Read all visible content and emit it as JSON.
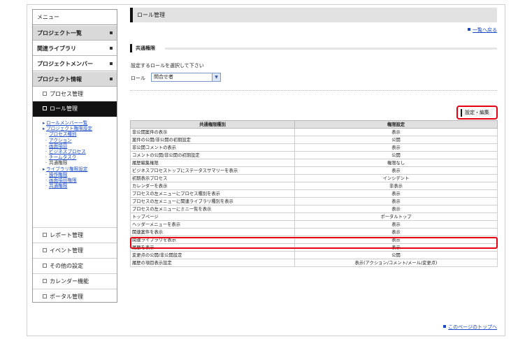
{
  "sidebar": {
    "menu": "メニュー",
    "top_items": [
      {
        "label": "プロジェクト一覧"
      },
      {
        "label": "関連ライブラリ"
      },
      {
        "label": "プロジェクトメンバー"
      },
      {
        "label": "プロジェクト情報"
      }
    ],
    "sub_items": [
      {
        "label": "プロセス管理"
      },
      {
        "label": "ロール管理"
      }
    ],
    "links": [
      {
        "label": "ロールメンバー一覧",
        "level": 1,
        "link": true
      },
      {
        "label": "プロジェクト権限設定",
        "level": 1,
        "link": true
      },
      {
        "label": "プロセス種別",
        "level": 2,
        "link": true
      },
      {
        "label": "アクション",
        "level": 2,
        "link": true
      },
      {
        "label": "画面項目",
        "level": 2,
        "link": true
      },
      {
        "label": "ビジネスプロセス",
        "level": 2,
        "link": true
      },
      {
        "label": "チームタスク",
        "level": 2,
        "link": true
      },
      {
        "label": "共通権限",
        "level": 2,
        "link": false
      },
      {
        "label": "ライブラリ権限設定",
        "level": 1,
        "link": true
      },
      {
        "label": "操作権限",
        "level": 2,
        "link": true
      },
      {
        "label": "画面項目権限",
        "level": 2,
        "link": true
      },
      {
        "label": "共通権限",
        "level": 2,
        "link": true
      }
    ],
    "bottom_items": [
      {
        "label": "レポート管理"
      },
      {
        "label": "イベント管理"
      },
      {
        "label": "その他の設定"
      },
      {
        "label": "カレンダー機能"
      },
      {
        "label": "ポータル管理"
      }
    ]
  },
  "main": {
    "title": "ロール管理",
    "back_link": "一覧へ戻る",
    "section_title": "共通権限",
    "description": "設定するロールを選択して下さい",
    "role_label": "ロール",
    "role_selected": "問合せ者",
    "edit_button": "設定・編集",
    "table": {
      "headers": [
        "共通権限種別",
        "権限設定"
      ],
      "rows": [
        [
          "非公開案件の表示",
          "表示"
        ],
        [
          "案件の公開/非公開の初期設定",
          "公開"
        ],
        [
          "非公開コメントの表示",
          "表示"
        ],
        [
          "コメントの公開/非公開の初期設定",
          "公開"
        ],
        [
          "履歴編集権限",
          "権限なし"
        ],
        [
          "ビジネスプロセストップにステータスサマリーを表示",
          "表示"
        ],
        [
          "初期表示プロセス",
          "インシデント"
        ],
        [
          "カレンダーを表示",
          "非表示"
        ],
        [
          "プロセスの左メニューにプロセス種別を表示",
          "表示"
        ],
        [
          "プロセスの左メニューに関連ライブラリ種別を表示",
          "表示"
        ],
        [
          "プロセスの左メニューにミニ一覧を表示",
          "表示"
        ],
        [
          "トップページ",
          "ポータルトップ"
        ],
        [
          "ヘッダーメニューを表示",
          "表示"
        ],
        [
          "関連案件を表示",
          "表示"
        ],
        [
          "関連ライブラリを表示",
          "表示"
        ],
        [
          "履歴を表示",
          "表示"
        ],
        [
          "変更点の公開/非公開設定",
          "公開"
        ],
        [
          "履歴の項目表示設定",
          "表示(アクション/コメント/メール/変更点)"
        ]
      ]
    },
    "page_top_link": "このページのトップへ"
  },
  "colors": {
    "highlight": "#e60012",
    "link": "#1a49c9",
    "active_bg": "#111111"
  }
}
